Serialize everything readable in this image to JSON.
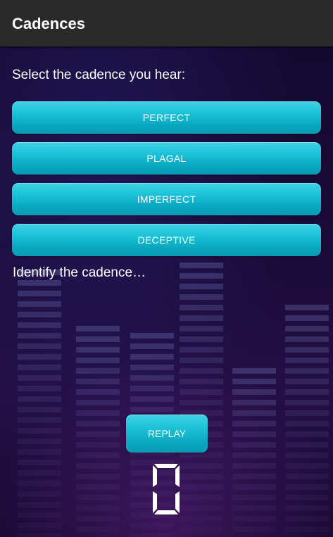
{
  "app_bar": {
    "title": "Cadences"
  },
  "prompt": "Select the cadence you hear:",
  "choices": [
    {
      "label": "PERFECT"
    },
    {
      "label": "PLAGAL"
    },
    {
      "label": "IMPERFECT"
    },
    {
      "label": "DECEPTIVE"
    }
  ],
  "status": "Identify the cadence…",
  "replay_label": "REPLAY",
  "score": "0",
  "colors": {
    "app_bar": "#2a2a2a",
    "button": "#18c0d6",
    "background": "#1a0c33",
    "text": "#ffffff"
  }
}
